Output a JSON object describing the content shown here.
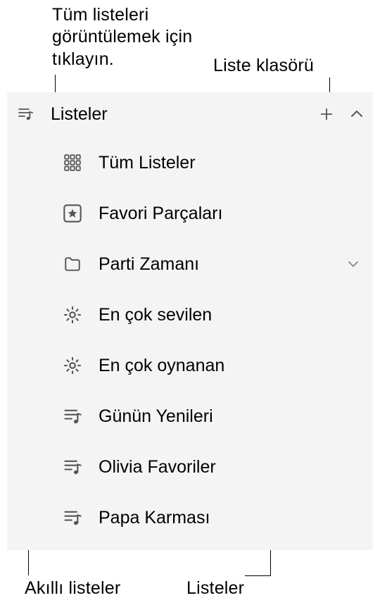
{
  "callouts": {
    "top_left": "Tüm listeleri görüntülemek için tıklayın.",
    "top_right": "Liste klasörü",
    "bottom_left": "Akıllı listeler",
    "bottom_right": "Listeler"
  },
  "header": {
    "title": "Listeler"
  },
  "items": [
    {
      "icon": "grid",
      "label": "Tüm Listeler",
      "type": "all"
    },
    {
      "icon": "star-box",
      "label": "Favori Parçaları",
      "type": "favorites"
    },
    {
      "icon": "folder",
      "label": "Parti Zamanı",
      "type": "folder",
      "expandable": true
    },
    {
      "icon": "gear",
      "label": "En çok sevilen",
      "type": "smart"
    },
    {
      "icon": "gear",
      "label": "En çok oynanan",
      "type": "smart"
    },
    {
      "icon": "playlist",
      "label": "Günün Yenileri",
      "type": "playlist"
    },
    {
      "icon": "playlist",
      "label": "Olivia Favoriler",
      "type": "playlist"
    },
    {
      "icon": "playlist",
      "label": "Papa Karması",
      "type": "playlist"
    }
  ]
}
